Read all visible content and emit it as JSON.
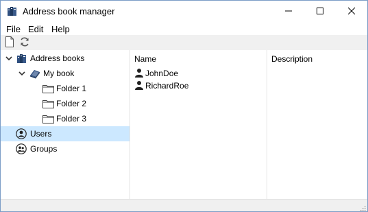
{
  "window": {
    "title": "Address book manager"
  },
  "menu": {
    "items": [
      "File",
      "Edit",
      "Help"
    ]
  },
  "toolbar": {
    "buttons": [
      "new-document-icon",
      "refresh-icon"
    ]
  },
  "tree": {
    "root_label": "Address books",
    "book_label": "My book",
    "folders": [
      "Folder 1",
      "Folder 2",
      "Folder 3"
    ],
    "users_label": "Users",
    "groups_label": "Groups",
    "selected": "Users"
  },
  "list": {
    "columns": [
      "Name",
      "Description"
    ],
    "rows": [
      "JohnDoe",
      "RichardRoe"
    ]
  },
  "colors": {
    "selection": "#cce8ff",
    "border": "#7a9cc6"
  }
}
